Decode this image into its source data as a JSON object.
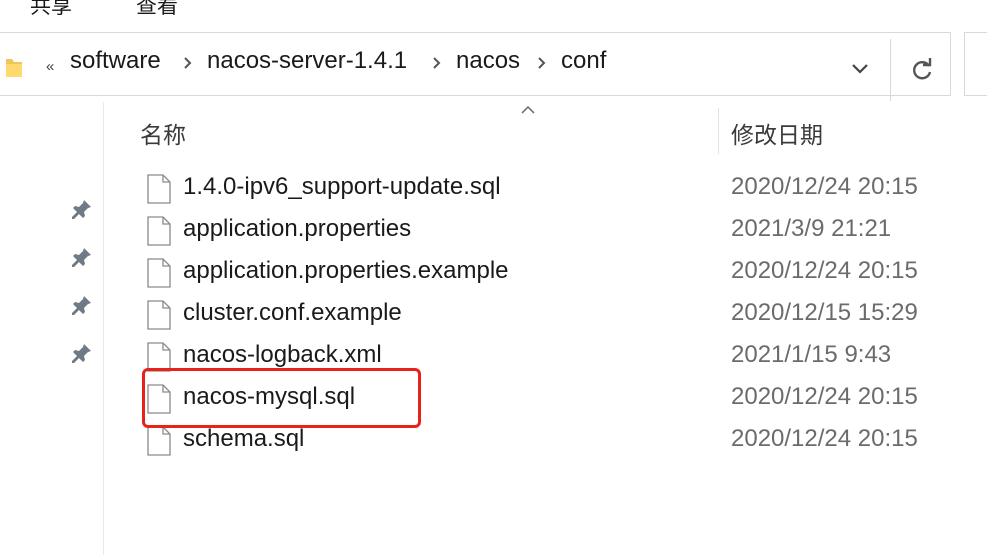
{
  "ribbon": {
    "tabs": [
      "共享",
      "查看"
    ]
  },
  "address_bar": {
    "overflow_marker": "«",
    "breadcrumbs": [
      "software",
      "nacos-server-1.4.1",
      "nacos",
      "conf"
    ]
  },
  "columns": {
    "name": "名称",
    "date_modified": "修改日期"
  },
  "files": [
    {
      "name": "1.4.0-ipv6_support-update.sql",
      "modified": "2020/12/24 20:15"
    },
    {
      "name": "application.properties",
      "modified": "2021/3/9 21:21"
    },
    {
      "name": "application.properties.example",
      "modified": "2020/12/24 20:15"
    },
    {
      "name": "cluster.conf.example",
      "modified": "2020/12/15 15:29"
    },
    {
      "name": "nacos-logback.xml",
      "modified": "2021/1/15 9:43"
    },
    {
      "name": "nacos-mysql.sql",
      "modified": "2020/12/24 20:15"
    },
    {
      "name": "schema.sql",
      "modified": "2020/12/24 20:15"
    }
  ],
  "annotation": {
    "highlight_color": "#e8221b"
  },
  "icons": {
    "folder": "folder-icon",
    "breadcrumb_separator": "chevron-right-icon",
    "history": "chevron-down-icon",
    "refresh": "refresh-icon",
    "pin": "pin-icon",
    "file": "file-icon",
    "sort": "sort-up-icon"
  }
}
